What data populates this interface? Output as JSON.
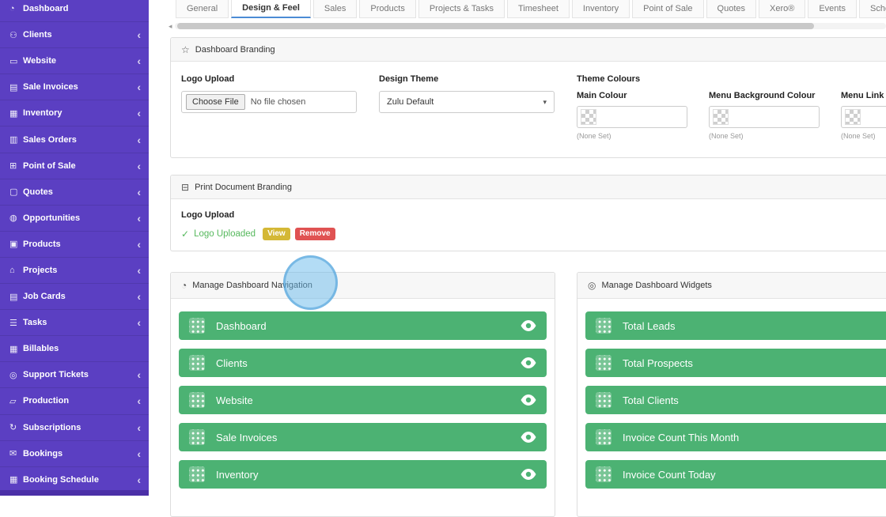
{
  "sidebar": {
    "items": [
      {
        "label": "Dashboard",
        "icon": "dashboard-icon",
        "glyph": "◔",
        "chevron": false
      },
      {
        "label": "Clients",
        "icon": "clients-icon",
        "glyph": "⚇",
        "chevron": true
      },
      {
        "label": "Website",
        "icon": "website-icon",
        "glyph": "▭",
        "chevron": true
      },
      {
        "label": "Sale Invoices",
        "icon": "sale-invoices-icon",
        "glyph": "▤",
        "chevron": true
      },
      {
        "label": "Inventory",
        "icon": "inventory-icon",
        "glyph": "▦",
        "chevron": true
      },
      {
        "label": "Sales Orders",
        "icon": "sales-orders-icon",
        "glyph": "▥",
        "chevron": true
      },
      {
        "label": "Point of Sale",
        "icon": "point-of-sale-icon",
        "glyph": "⊞",
        "chevron": true
      },
      {
        "label": "Quotes",
        "icon": "quotes-icon",
        "glyph": "▢",
        "chevron": true
      },
      {
        "label": "Opportunities",
        "icon": "opportunities-icon",
        "glyph": "◍",
        "chevron": true
      },
      {
        "label": "Products",
        "icon": "products-icon",
        "glyph": "▣",
        "chevron": true
      },
      {
        "label": "Projects",
        "icon": "projects-icon",
        "glyph": "⌂",
        "chevron": true
      },
      {
        "label": "Job Cards",
        "icon": "job-cards-icon",
        "glyph": "▤",
        "chevron": true
      },
      {
        "label": "Tasks",
        "icon": "tasks-icon",
        "glyph": "☰",
        "chevron": true
      },
      {
        "label": "Billables",
        "icon": "billables-icon",
        "glyph": "▦",
        "chevron": false
      },
      {
        "label": "Support Tickets",
        "icon": "support-tickets-icon",
        "glyph": "◎",
        "chevron": true
      },
      {
        "label": "Production",
        "icon": "production-icon",
        "glyph": "▱",
        "chevron": true
      },
      {
        "label": "Subscriptions",
        "icon": "subscriptions-icon",
        "glyph": "↻",
        "chevron": true
      },
      {
        "label": "Bookings",
        "icon": "bookings-icon",
        "glyph": "✉",
        "chevron": true
      },
      {
        "label": "Booking Schedule",
        "icon": "booking-schedule-icon",
        "glyph": "▦",
        "chevron": true
      }
    ]
  },
  "tabs": [
    {
      "label": "General",
      "active": false
    },
    {
      "label": "Design & Feel",
      "active": true
    },
    {
      "label": "Sales",
      "active": false
    },
    {
      "label": "Products",
      "active": false
    },
    {
      "label": "Projects & Tasks",
      "active": false
    },
    {
      "label": "Timesheet",
      "active": false
    },
    {
      "label": "Inventory",
      "active": false
    },
    {
      "label": "Point of Sale",
      "active": false
    },
    {
      "label": "Quotes",
      "active": false
    },
    {
      "label": "Xero®",
      "active": false
    },
    {
      "label": "Events",
      "active": false
    },
    {
      "label": "Schedule",
      "active": false
    }
  ],
  "dashboard_branding": {
    "title": "Dashboard Branding",
    "logo_upload_label": "Logo Upload",
    "choose_file_label": "Choose File",
    "file_status": "No file chosen",
    "design_theme_label": "Design Theme",
    "design_theme_value": "Zulu Default",
    "theme_colours_label": "Theme Colours",
    "colours": [
      {
        "label": "Main Colour",
        "value": "(None Set)"
      },
      {
        "label": "Menu Background Colour",
        "value": "(None Set)"
      },
      {
        "label": "Menu Link Colour",
        "value": "(None Set)"
      }
    ]
  },
  "print_branding": {
    "title": "Print Document Branding",
    "logo_upload_label": "Logo Upload",
    "status": "Logo Uploaded",
    "view_label": "View",
    "remove_label": "Remove"
  },
  "manage_navigation": {
    "title": "Manage Dashboard Navigation",
    "items": [
      "Dashboard",
      "Clients",
      "Website",
      "Sale Invoices",
      "Inventory"
    ]
  },
  "manage_widgets": {
    "title": "Manage Dashboard Widgets",
    "items": [
      "Total Leads",
      "Total Prospects",
      "Total Clients",
      "Invoice Count This Month",
      "Invoice Count Today"
    ]
  },
  "colors": {
    "sidebar": "#5B3FC2",
    "green_bar": "#4CB273",
    "success_text": "#55B85C",
    "view_badge": "#D4B836",
    "remove_badge": "#E05252",
    "active_tab_underline": "#4B8BD5"
  }
}
